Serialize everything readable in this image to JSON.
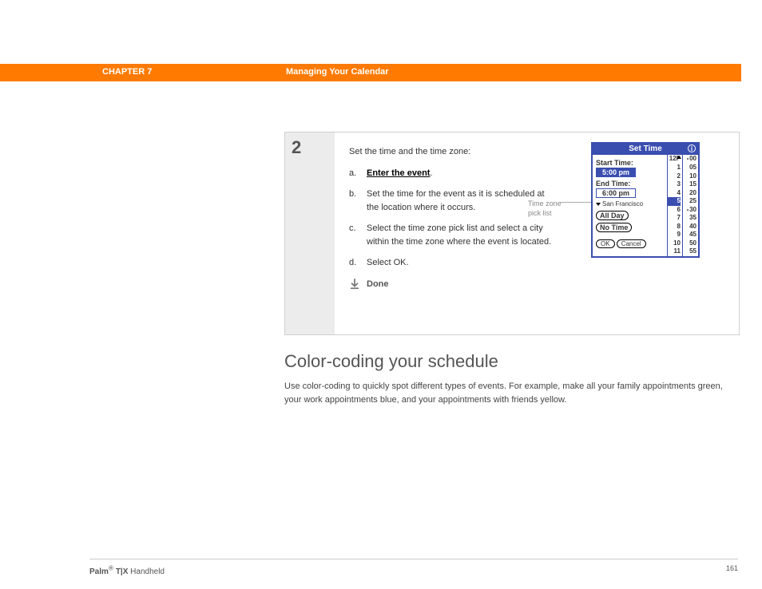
{
  "header": {
    "chapter": "CHAPTER 7",
    "title": "Managing Your Calendar"
  },
  "step": {
    "number": "2",
    "intro": "Set the time and the time zone:",
    "items": [
      {
        "lbl": "a.",
        "html_link": "Enter the event",
        "suffix": "."
      },
      {
        "lbl": "b.",
        "text": "Set the time for the event as it is scheduled at the location where it occurs."
      },
      {
        "lbl": "c.",
        "text": "Select the time zone pick list and select a city within the time zone where the event is located."
      },
      {
        "lbl": "d.",
        "text": "Select OK."
      }
    ],
    "done": "Done"
  },
  "callout": {
    "line1": "Time zone",
    "line2": "pick list"
  },
  "palm": {
    "title": "Set Time",
    "start_label": "Start Time:",
    "start_value": "5:00 pm",
    "end_label": "End Time:",
    "end_value": "6:00 pm",
    "city": "San Francisco",
    "all_day": "All Day",
    "no_time": "No Time",
    "ok": "OK",
    "cancel": "Cancel",
    "hours": [
      "12P",
      "1",
      "2",
      "3",
      "4",
      "5",
      "6",
      "7",
      "8",
      "9",
      "10",
      "11"
    ],
    "hour_selected": "5",
    "mins": [
      "00",
      "05",
      "10",
      "15",
      "20",
      "25",
      "30",
      "35",
      "40",
      "45",
      "50",
      "55"
    ],
    "min_dotted": [
      "00",
      "30"
    ]
  },
  "section": {
    "heading": "Color-coding your schedule",
    "body": "Use color-coding to quickly spot different types of events. For example, make all your family appointments green, your work appointments blue, and your appointments with friends yellow."
  },
  "footer": {
    "brand_a": "Palm",
    "reg": "®",
    "brand_b": " T|X",
    "tail": " Handheld",
    "page": "161"
  }
}
